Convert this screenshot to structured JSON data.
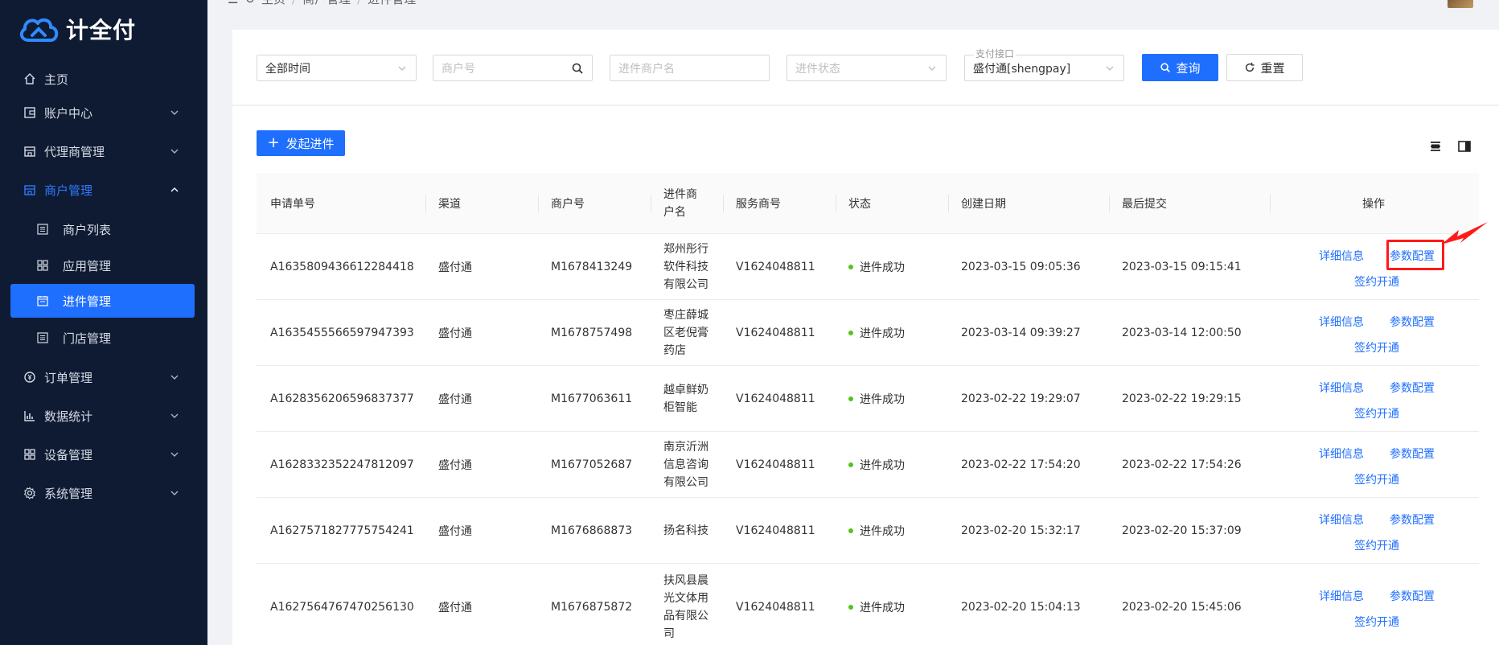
{
  "app": {
    "logo_text": "计全付"
  },
  "breadcrumb": [
    "主页",
    "商户管理",
    "进件管理"
  ],
  "sidebar": {
    "items": [
      {
        "label": "主页",
        "icon": "home-icon"
      },
      {
        "label": "账户中心",
        "icon": "wallet-icon"
      },
      {
        "label": "代理商管理",
        "icon": "store-icon"
      },
      {
        "label": "商户管理",
        "icon": "shop-icon"
      },
      {
        "label": "订单管理",
        "icon": "order-icon"
      },
      {
        "label": "数据统计",
        "icon": "chart-icon"
      },
      {
        "label": "设备管理",
        "icon": "grid-icon"
      },
      {
        "label": "系统管理",
        "icon": "gear-icon"
      }
    ],
    "sub_items": [
      {
        "label": "商户列表",
        "icon": "list-icon"
      },
      {
        "label": "应用管理",
        "icon": "apps-icon"
      },
      {
        "label": "进件管理",
        "icon": "calendar-icon"
      },
      {
        "label": "门店管理",
        "icon": "list-icon"
      }
    ]
  },
  "search": {
    "time_select": "全部时间",
    "merchant_no_placeholder": "商户号",
    "merchant_name_placeholder": "进件商户名",
    "status_placeholder": "进件状态",
    "pay_interface_label": "支付接口",
    "pay_interface_value": "盛付通[shengpay]",
    "query_label": "查询",
    "reset_label": "重置"
  },
  "toolbar": {
    "add_label": "发起进件"
  },
  "table": {
    "headers": [
      "申请单号",
      "渠道",
      "商户号",
      "进件商户名",
      "服务商号",
      "状态",
      "创建日期",
      "最后提交",
      "操作"
    ],
    "header_name_lines": [
      "进件商",
      "户名"
    ],
    "actions": {
      "detail": "详细信息",
      "params": "参数配置",
      "sign": "签约开通"
    },
    "rows": [
      {
        "id": "A1635809436612284418",
        "channel": "盛付通",
        "merchant_no": "M1678413249",
        "name_lines": [
          "郑州彤行",
          "软件科技",
          "有限公司"
        ],
        "service_no": "V1624048811",
        "status": "进件成功",
        "created": "2023-03-15 09:05:36",
        "submitted": "2023-03-15 09:15:41"
      },
      {
        "id": "A1635455566597947393",
        "channel": "盛付通",
        "merchant_no": "M1678757498",
        "name_lines": [
          "枣庄薛城",
          "区老倪膏",
          "药店"
        ],
        "service_no": "V1624048811",
        "status": "进件成功",
        "created": "2023-03-14 09:39:27",
        "submitted": "2023-03-14 12:00:50"
      },
      {
        "id": "A1628356206596837377",
        "channel": "盛付通",
        "merchant_no": "M1677063611",
        "name_lines": [
          "越卓鲜奶",
          "柜智能"
        ],
        "service_no": "V1624048811",
        "status": "进件成功",
        "created": "2023-02-22 19:29:07",
        "submitted": "2023-02-22 19:29:15"
      },
      {
        "id": "A1628332352247812097",
        "channel": "盛付通",
        "merchant_no": "M1677052687",
        "name_lines": [
          "南京沂洲",
          "信息咨询",
          "有限公司"
        ],
        "service_no": "V1624048811",
        "status": "进件成功",
        "created": "2023-02-22 17:54:20",
        "submitted": "2023-02-22 17:54:26"
      },
      {
        "id": "A1627571827775754241",
        "channel": "盛付通",
        "merchant_no": "M1676868873",
        "name_lines": [
          "扬名科技"
        ],
        "service_no": "V1624048811",
        "status": "进件成功",
        "created": "2023-02-20 15:32:17",
        "submitted": "2023-02-20 15:37:09"
      },
      {
        "id": "A1627564767470256130",
        "channel": "盛付通",
        "merchant_no": "M1676875872",
        "name_lines": [
          "扶风县晨",
          "光文体用",
          "品有限公",
          "司"
        ],
        "service_no": "V1624048811",
        "status": "进件成功",
        "created": "2023-02-20 15:04:13",
        "submitted": "2023-02-20 15:45:06"
      }
    ]
  },
  "colors": {
    "sidebar_bg": "#0f1b33",
    "primary": "#1f6fff",
    "success": "#52c41a",
    "annotation": "#ff1a1a"
  }
}
